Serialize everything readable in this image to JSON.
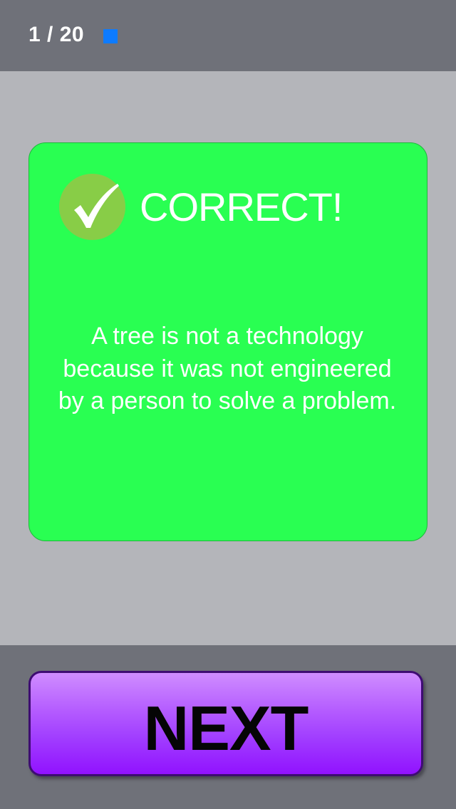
{
  "header": {
    "progress": "1 / 20"
  },
  "card": {
    "status_icon": "checkmark-icon",
    "heading": "CORRECT!",
    "explanation": "A tree is not a technology because it was not engineered by a person to solve a problem."
  },
  "footer": {
    "next_label": "NEXT"
  },
  "colors": {
    "header_bg": "#6f7179",
    "content_bg": "#b4b5ba",
    "card_bg": "#29ff52",
    "badge_bg": "#88cd47",
    "progress_marker": "#0d7bff",
    "button_top": "#cf8dff",
    "button_bottom": "#9112ff",
    "button_border": "#3e0c73"
  }
}
